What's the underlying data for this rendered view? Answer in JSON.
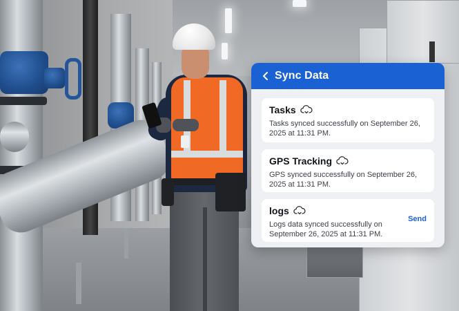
{
  "panel": {
    "title": "Sync Data",
    "back_icon": "chevron-left-icon",
    "accent_color": "#1a61d4",
    "items": [
      {
        "title": "Tasks",
        "icon": "cloud-sync-icon",
        "description": "Tasks synced successfully on September 26, 2025 at 11:31 PM."
      },
      {
        "title": "GPS Tracking",
        "icon": "cloud-sync-icon",
        "description": "GPS synced successfully on September 26, 2025 at 11:31 PM."
      },
      {
        "title": "logs",
        "icon": "cloud-sync-icon",
        "description": "Logs data synced successfully on September 26, 2025 at 11:31 PM.",
        "action_label": "Send"
      }
    ]
  }
}
